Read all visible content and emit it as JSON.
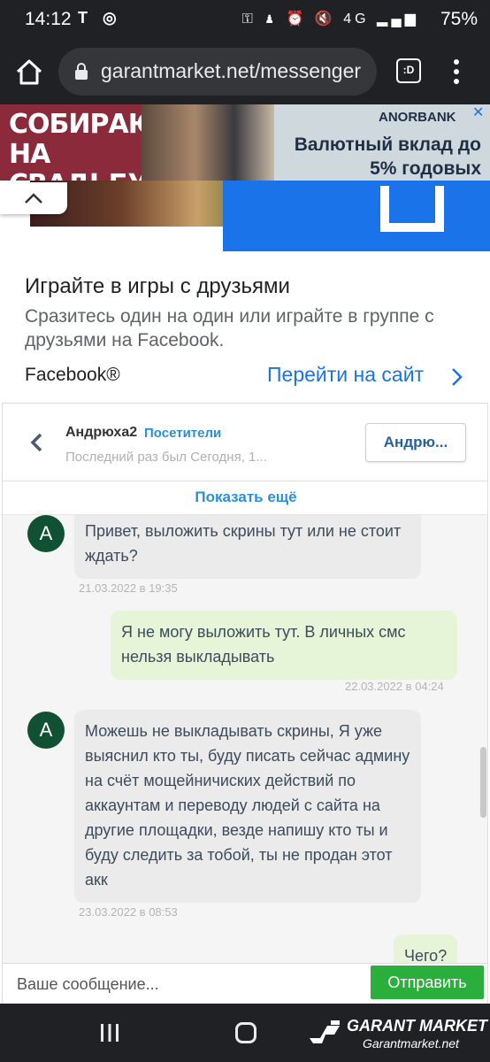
{
  "status_bar": {
    "time": "14:12",
    "left_icons": "T ◎",
    "right_icons": "⚿ ♟ ⏰ 🔇 4G ▂▄▆",
    "battery": "75%"
  },
  "browser": {
    "url": "garantmarket.net/messenger",
    "tab_count": ":D"
  },
  "banner_ad": {
    "left_text": "СОБИРАЮ НА СВАДЬБУ",
    "brand": "ANORBANK",
    "text": "Валютный вклад до 5% годовых"
  },
  "fb_ad": {
    "title": "Играйте в игры с друзьями",
    "description": "Сразитесь один на один или играйте в группе с друзьями на Facebook.",
    "brand": "Facebook®",
    "cta": "Перейти на сайт"
  },
  "chat": {
    "name": "Андрюха2",
    "role": "Посетители",
    "last_seen": "Последний раз был Сегодня, 1...",
    "profile_button": "Андрю...",
    "show_more": "Показать ещё",
    "messages": [
      {
        "dir": "in",
        "avatar": "A",
        "text": "Привет, выложить скрины тут или не стоит ждать?",
        "time": "21.03.2022 в 19:35"
      },
      {
        "dir": "out",
        "text": "Я не могу выложить тут. В личных смс нельзя выкладывать",
        "time": "22.03.2022 в 04:24"
      },
      {
        "dir": "in",
        "avatar": "A",
        "text": "Можешь не выкладывать скрины, Я уже выяснил кто ты, буду писать сейчас админу на счёт мощейничиских действий по аккаунтам и переводу людей с сайта на другие площадки, везде напишу кто ты и буду следить за тобой, ты не продан этот акк",
        "time": "23.03.2022 в 08:53"
      },
      {
        "dir": "out",
        "text": "Чего?",
        "time": ""
      }
    ],
    "composer_placeholder": "Ваше сообщение...",
    "send_label": "Отправить"
  },
  "watermark": {
    "title": "GARANT MARKET",
    "subtitle": "Garantmarket.net"
  }
}
